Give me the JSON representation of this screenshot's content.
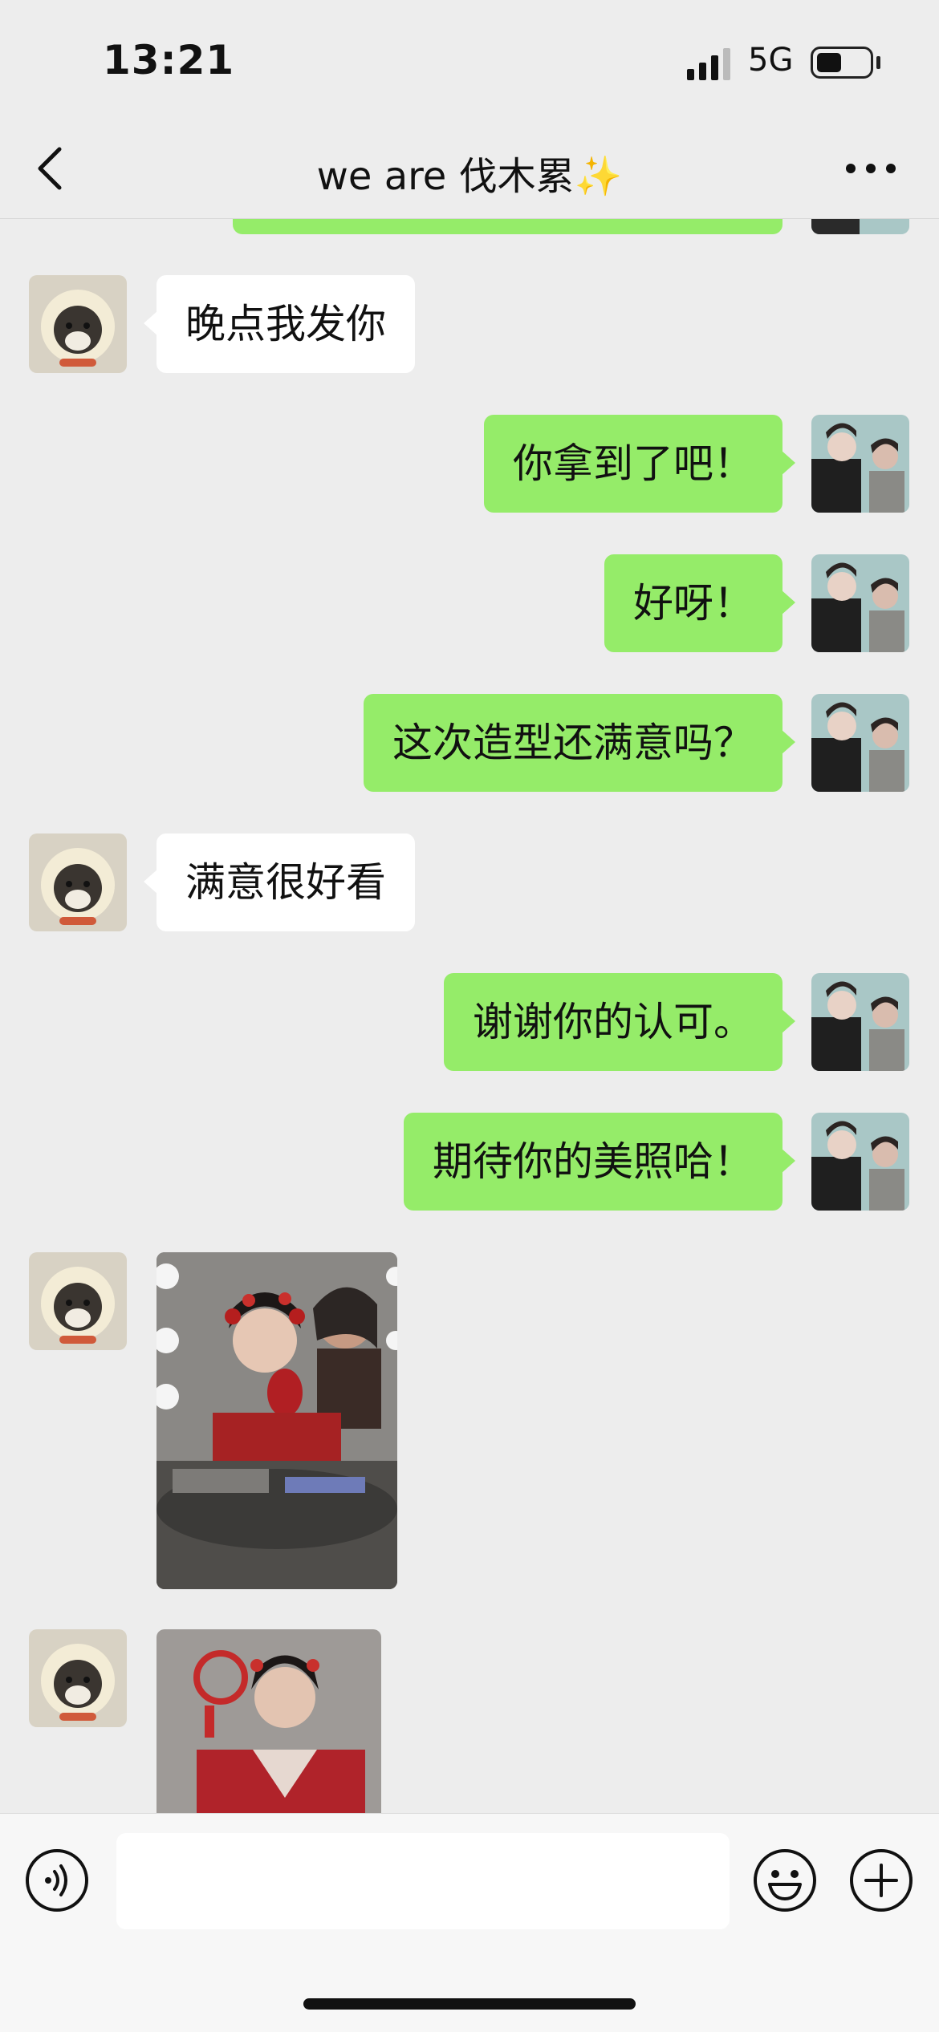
{
  "status_bar": {
    "time": "13:21",
    "network": "5G"
  },
  "nav": {
    "title": "we are 伐木累✨",
    "back_icon": "chevron-left-icon",
    "more_icon": "ellipsis-icon"
  },
  "messages": [
    {
      "side": "in",
      "type": "text",
      "text": "晚点我发你"
    },
    {
      "side": "out",
      "type": "text",
      "text": "你拿到了吧！"
    },
    {
      "side": "out",
      "type": "text",
      "text": "好呀！"
    },
    {
      "side": "out",
      "type": "text",
      "text": "这次造型还满意吗？"
    },
    {
      "side": "in",
      "type": "text",
      "text": "满意很好看"
    },
    {
      "side": "out",
      "type": "text",
      "text": "谢谢你的认可。"
    },
    {
      "side": "out",
      "type": "text",
      "text": "期待你的美照哈！"
    },
    {
      "side": "in",
      "type": "image"
    },
    {
      "side": "in",
      "type": "image"
    }
  ],
  "input_bar": {
    "placeholder": "",
    "voice_icon": "voice-icon",
    "emoji_icon": "emoji-icon",
    "plus_icon": "plus-circle-icon"
  },
  "colors": {
    "background": "#ededed",
    "outgoing_bubble": "#95ec69",
    "incoming_bubble": "#ffffff"
  }
}
